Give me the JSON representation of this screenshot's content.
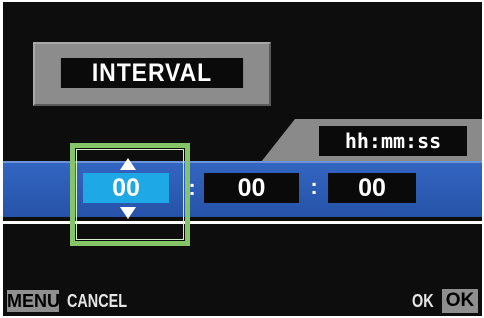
{
  "screen": {
    "title": "INTERVAL",
    "format_label": "hh:mm:ss"
  },
  "time": {
    "hours": "00",
    "minutes": "00",
    "seconds": "00",
    "separator": ":",
    "selected_field": "hours"
  },
  "footer": {
    "menu_key": "MENU",
    "cancel_label": "CANCEL",
    "ok_label": "OK",
    "ok_key": "OK"
  },
  "icons": {
    "increment": "arrow-up-icon",
    "decrement": "arrow-down-icon"
  },
  "colors": {
    "background": "#0d0d0d",
    "band_blue": "#2f5fb8",
    "selected_field": "#1fa8e6",
    "selection_frame": "#86c468",
    "plate_gray": "#8c8c8c"
  }
}
